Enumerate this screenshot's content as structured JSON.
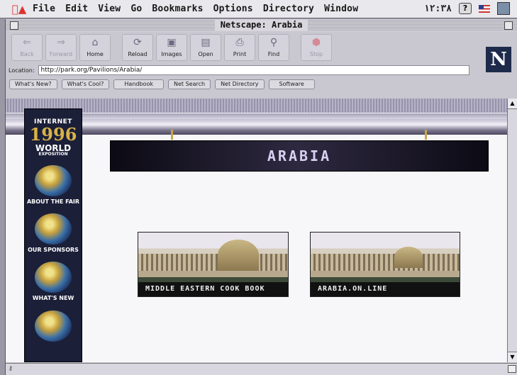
{
  "menubar": {
    "items": [
      "File",
      "Edit",
      "View",
      "Go",
      "Bookmarks",
      "Options",
      "Directory",
      "Window"
    ],
    "clock": "١٢:٣٨",
    "help": "?"
  },
  "window": {
    "title": "Netscape: Arabia"
  },
  "toolbar": {
    "buttons": [
      {
        "label": "Back",
        "icon": "back-arrow-icon",
        "enabled": false
      },
      {
        "label": "Forward",
        "icon": "forward-arrow-icon",
        "enabled": false
      },
      {
        "label": "Home",
        "icon": "home-icon",
        "enabled": true
      },
      {
        "label": "Reload",
        "icon": "reload-icon",
        "enabled": true
      },
      {
        "label": "Images",
        "icon": "images-icon",
        "enabled": true
      },
      {
        "label": "Open",
        "icon": "open-icon",
        "enabled": true
      },
      {
        "label": "Print",
        "icon": "print-icon",
        "enabled": true
      },
      {
        "label": "Find",
        "icon": "find-icon",
        "enabled": true
      },
      {
        "label": "Stop",
        "icon": "stop-icon",
        "enabled": false
      }
    ],
    "logo": "N"
  },
  "location": {
    "label": "Location:",
    "url": "http://park.org/Pavilions/Arabia/"
  },
  "directory_buttons": [
    "What's New?",
    "What's Cool?",
    "Handbook",
    "Net Search",
    "Net Directory",
    "Software"
  ],
  "page": {
    "nav": {
      "line1": "INTERNET",
      "year": "1996",
      "line2": "WORLD",
      "line3": "EXPOSITION",
      "items": [
        "ABOUT THE FAIR",
        "OUR SPONSORS",
        "WHAT'S NEW"
      ]
    },
    "banner": "ARABIA",
    "links": [
      {
        "caption": "MIDDLE EASTERN COOK BOOK"
      },
      {
        "caption": "ARABIA.ON.LINE"
      }
    ]
  },
  "colors": {
    "accent": "#1b1f38",
    "banner": "#1a1726"
  }
}
